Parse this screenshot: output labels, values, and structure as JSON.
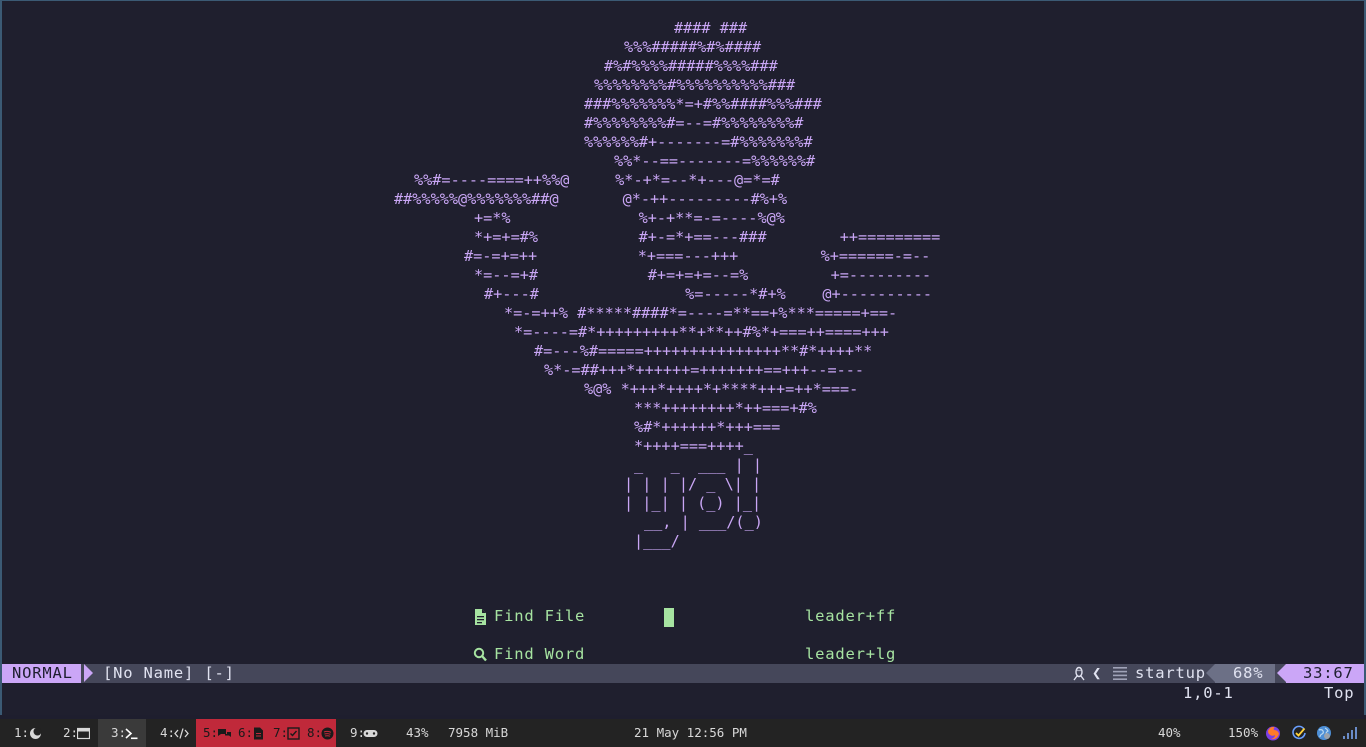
{
  "editor": {
    "ascii_art": [
      "#### ###",
      "%%%#####%#%####",
      "#%#%%%%#####%%%%###",
      "%%%%%%%%#%%%%%%%%%%###",
      "###%%%%%%%*=+#%%####%%%###",
      "#%%%%%%%%#=--=#%%%%%%%%#",
      "%%%%%%#+-------=#%%%%%%%#",
      "%%*--==-------=%%%%%%#",
      "%%#=----====++%%@     %*-+*=--*+---@=*=#",
      "##%%%%%@%%%%%%%##@       @*-++---------#%+%",
      "+=*%              %+-+**=-=----%@%",
      "*+=+=#%           #+-=*+==---###        ++=========",
      "#=-=+=++           *+===---+++         %+======-=--",
      "*=--=+#            #+=+=+=--=%         +=---------",
      "#+---#                %=-----*#+%    @+----------",
      "*=-=++% #*****####*=----=**==+%***=====+==-",
      "*=----=#*+++++++++**+**++#%*+===++====+++",
      "#=---%#=====+++++++++++++++**#*++++**",
      "%*-=##+++*++++++=+++++++==+++--=---",
      "%@% *+++*++++*+****+++=++*===-",
      "***++++++++*++===+#%",
      "%#*++++++*+++===",
      "*++++===++++_",
      "_   _  ___ | |",
      "| | | |/ _ \\| |",
      "| |_| | (_) |_|",
      "__, | ___/(_)",
      "|___/"
    ],
    "menu": [
      {
        "icon": "file-icon",
        "label": "Find File",
        "keys": "leader+ff"
      },
      {
        "icon": "search-icon",
        "label": "Find Word",
        "keys": "leader+lg"
      }
    ]
  },
  "statusline": {
    "mode": "NORMAL",
    "file": "[No Name] [-]",
    "filetype": "startup",
    "percent": "68%",
    "position": "33:67",
    "colors": {
      "mode_bg": "#cba6f7",
      "bar_bg": "#45475a",
      "pct_bg": "#6c7086"
    }
  },
  "cmdline": {
    "ruler": "1,0-1",
    "scroll": "Top"
  },
  "taskbar": {
    "workspaces": [
      {
        "label": "1:",
        "icon": "moon-icon"
      },
      {
        "label": "2:",
        "icon": "window-icon"
      },
      {
        "label": "3:",
        "icon": "terminal-icon",
        "active": true
      },
      {
        "label": "4:",
        "icon": "code-icon"
      },
      {
        "label": "5:",
        "icon": "chat-icon",
        "urgent": true
      },
      {
        "label": "6:",
        "icon": "document-icon",
        "urgent": true
      },
      {
        "label": "7:",
        "icon": "checkbox-icon",
        "urgent": true
      },
      {
        "label": "8:",
        "icon": "spotify-icon",
        "urgent": true
      },
      {
        "label": "9:",
        "icon": "gamepad-icon"
      }
    ],
    "cpu": "43%",
    "memory": "7958 MiB",
    "datetime": "21 May 12:56 PM",
    "brightness": "40%",
    "volume": "150%",
    "tray": [
      "firefox-icon",
      "tasks-icon",
      "globe-icon",
      "wifi-signal-icon"
    ],
    "colors": {
      "urgent_bg": "#c0293a",
      "active_bg": "#3a3a3a"
    }
  }
}
